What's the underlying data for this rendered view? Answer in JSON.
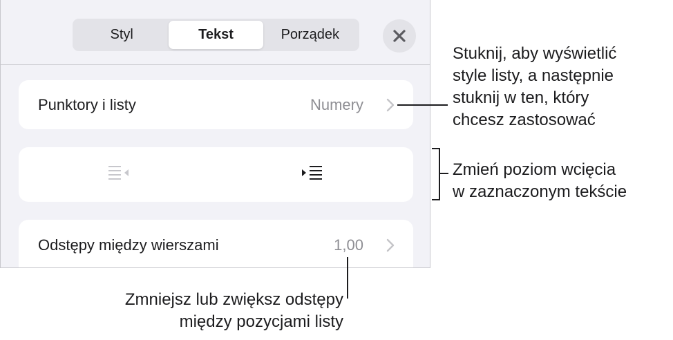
{
  "tabs": [
    {
      "label": "Styl",
      "active": false
    },
    {
      "label": "Tekst",
      "active": true
    },
    {
      "label": "Porządek",
      "active": false
    }
  ],
  "close": {
    "icon": "close-icon"
  },
  "rows": {
    "bullets": {
      "label": "Punktory i listy",
      "value": "Numery",
      "icon": "chevron-right-icon"
    },
    "indent": {
      "outdent_icon": "outdent-icon",
      "indent_icon": "indent-icon"
    },
    "spacing": {
      "label": "Odstępy między wierszami",
      "value": "1,00",
      "icon": "chevron-right-icon"
    }
  },
  "callouts": {
    "list_styles": {
      "lines": [
        "Stuknij, aby wyświetlić",
        "style listy, a następnie",
        "stuknij w ten, który",
        "chcesz zastosować"
      ]
    },
    "indent": {
      "lines": [
        "Zmień poziom wcięcia",
        "w zaznaczonym tekście"
      ]
    },
    "spacing": {
      "lines": [
        "Zmniejsz lub zwiększ odstępy",
        "między pozycjami listy"
      ]
    }
  },
  "colors": {
    "panel_bg": "#f2f2f7",
    "row_bg": "#ffffff",
    "segment_bg": "#e3e3e8",
    "text": "#1c1c1e",
    "secondary_text": "#8e8e93",
    "icon_gray": "#8e8e93"
  }
}
